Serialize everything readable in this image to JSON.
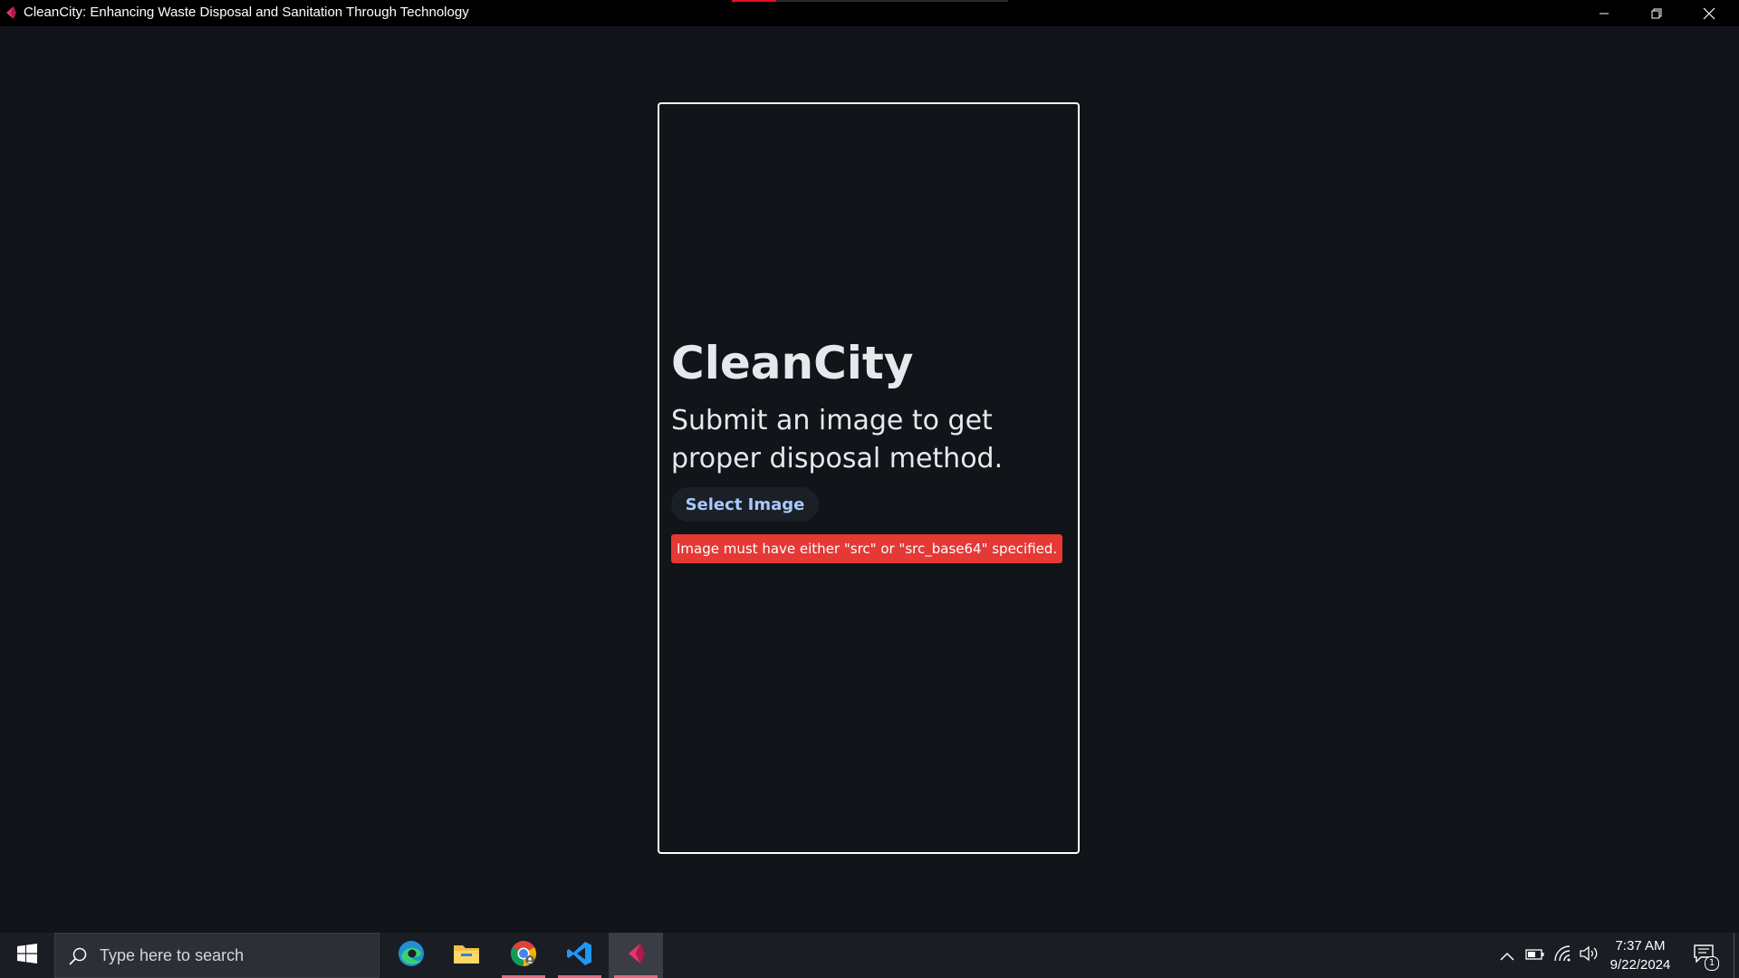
{
  "window": {
    "title": "CleanCity: Enhancing Waste Disposal and Sanitation Through Technology",
    "icon": "flet-icon",
    "loading_progress": 0.16,
    "controls": [
      "minimize-icon",
      "restore-icon",
      "close-icon"
    ]
  },
  "app": {
    "heading": "CleanCity",
    "subtitle": "Submit an image to get proper disposal method.",
    "select_button_label": "Select Image",
    "error_message": "Image must have either \"src\" or \"src_base64\" specified.",
    "colors": {
      "background": "#111418",
      "card_border": "#ffffff",
      "button_text": "#a9c8ff",
      "error_background": "#e53935"
    }
  },
  "taskbar": {
    "search_placeholder": "Type here to search",
    "pinned_apps": [
      {
        "name": "edge-icon",
        "active": false,
        "running": false
      },
      {
        "name": "file-explorer-icon",
        "active": false,
        "running": false
      },
      {
        "name": "chrome-icon",
        "active": false,
        "running": true
      },
      {
        "name": "vscode-icon",
        "active": false,
        "running": true
      },
      {
        "name": "flet-app-icon",
        "active": true,
        "running": true
      }
    ],
    "tray_icons": [
      "chevron-up-icon",
      "battery-icon",
      "wifi-icon",
      "volume-icon"
    ],
    "time": "7:37 AM",
    "date": "9/22/2024",
    "notification_count": "1"
  }
}
